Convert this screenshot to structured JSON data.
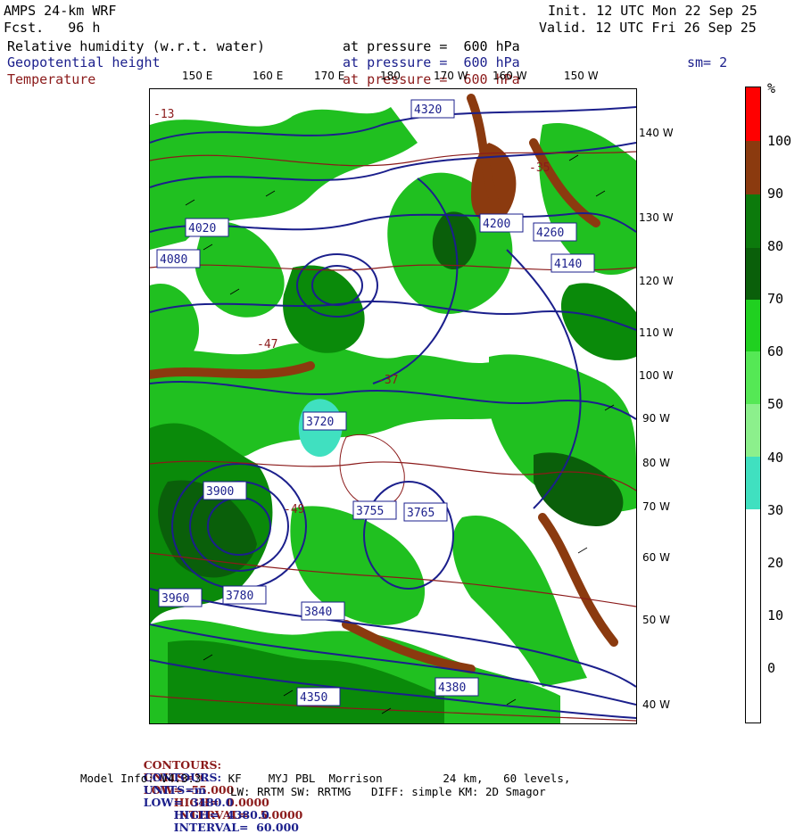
{
  "header": {
    "model": "AMPS 24-km WRF",
    "fcst": "Fcst.   96 h",
    "init": "Init. 12 UTC Mon 22 Sep 25",
    "valid": "Valid. 12 UTC Fri 26 Sep 25",
    "fields": [
      {
        "name": "Relative humidity (w.r.t. water)",
        "level": "at pressure =  600 hPa",
        "color": "#000000"
      },
      {
        "name": "Geopotential height",
        "level": "at pressure =  600 hPa",
        "color": "#1b1f8c"
      },
      {
        "name": "Temperature",
        "level": "at pressure =  600 hPa",
        "color": "#8b1a1a"
      }
    ],
    "smoothing": "sm= 2"
  },
  "axes": {
    "lon_labels": [
      "150 E",
      "160 E",
      "170 E",
      "180",
      "170 W",
      "160 W",
      "150 W"
    ],
    "lat_labels": [
      "140 W",
      "130 W",
      "120 W",
      "110 W",
      "100 W",
      "90 W",
      "80 W",
      "70 W",
      "60 W",
      "50 W",
      "40 W"
    ]
  },
  "colorbar": {
    "unit": "%",
    "labels": [
      "100",
      "90",
      "80",
      "70",
      "60",
      "50",
      "40",
      "30",
      "20",
      "10",
      "0"
    ],
    "colors": [
      "#ff0000",
      "#8b3a0f",
      "#0c7a0c",
      "#0a5f0a",
      "#20d020",
      "#55e855",
      "#8cf08c",
      "#40e0c0",
      "#ffffff",
      "#ffffff",
      "#ffffff",
      "#ffffff"
    ]
  },
  "map": {
    "height_labels": [
      "4320",
      "4260",
      "4200",
      "4140",
      "4080",
      "4020",
      "3960",
      "3900",
      "3840",
      "3780",
      "3720",
      "3755",
      "3765",
      "4380",
      "4350"
    ],
    "temp_labels": [
      "-13",
      "-35",
      "-37",
      "-47",
      "-49"
    ],
    "features": {
      "land": "#20c020",
      "ocean": "#ffffff",
      "height_contour_color": "#1b1f8c",
      "temp_contour_color": "#8b1a1a",
      "high_humidity": "#0a5f0a"
    }
  },
  "footer": {
    "temp_contours": {
      "label": "CONTOURS:",
      "units": "UNITS=°C",
      "low": "LOW= -55.000",
      "high": "HIGH=  0.0000",
      "interval": "INTERVAL=   5.0000",
      "color": "#8b1a1a"
    },
    "height_contours": {
      "label": "CONTOURS:",
      "units": "UNITS=m",
      "low": "LOW=  3480.0",
      "high": "HIGH=  4380.0",
      "interval": "INTERVAL=  60.000",
      "color": "#1b1f8c"
    },
    "model_info": "Model Info: V4.3.3    KF    MYJ PBL  Morrison         24 km,   60 levels,",
    "model_info2": "LW: RRTM SW: RRTMG   DIFF: simple KM: 2D Smagor"
  }
}
